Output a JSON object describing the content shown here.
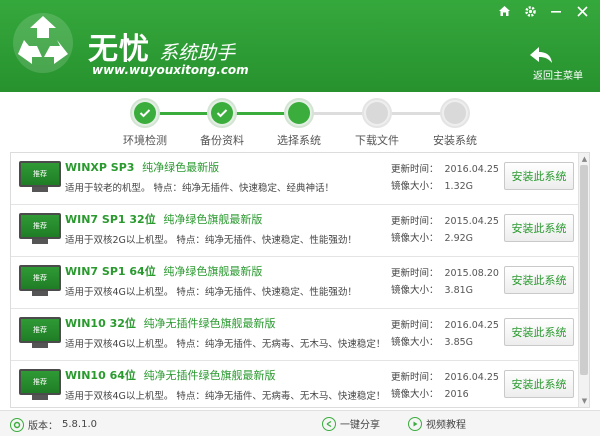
{
  "brand": {
    "name": "无忧",
    "tagline": "系统助手",
    "url": "www.wuyouxitong.com"
  },
  "header": {
    "back_label": "返回主菜单",
    "controls": [
      "home-icon",
      "gear-icon",
      "minimize-icon",
      "close-icon"
    ]
  },
  "steps": [
    {
      "label": "环境检测",
      "state": "done"
    },
    {
      "label": "备份资料",
      "state": "done"
    },
    {
      "label": "选择系统",
      "state": "current"
    },
    {
      "label": "下载文件",
      "state": "todo"
    },
    {
      "label": "安装系统",
      "state": "todo"
    }
  ],
  "list": {
    "thumb_label": "推荐",
    "updated_label": "更新时间：",
    "size_label": "镜像大小：",
    "install_label": "安装此系统",
    "items": [
      {
        "name": "WINXP SP3",
        "subtitle": "纯净绿色最新版",
        "desc": "适用于较老的机型。 特点：纯净无插件、快速稳定、经典神话！",
        "date": "2016.04.25",
        "size": "1.32G"
      },
      {
        "name": "WIN7 SP1 32位",
        "subtitle": "纯净绿色旗舰最新版",
        "desc": "适用于双核2G以上机型。 特点：纯净无插件、快速稳定、性能强劲！",
        "date": "2015.04.25",
        "size": "2.92G"
      },
      {
        "name": "WIN7 SP1 64位",
        "subtitle": "纯净绿色旗舰最新版",
        "desc": "适用于双核4G以上机型。 特点：纯净无插件、快速稳定、性能强劲！",
        "date": "2015.08.20",
        "size": "3.81G"
      },
      {
        "name": "WIN10 32位",
        "subtitle": "纯净无插件绿色旗舰最新版",
        "desc": "适用于双核4G以上机型。 特点：纯净无插件、无病毒、无木马、快速稳定！",
        "date": "2016.04.25",
        "size": "3.85G"
      },
      {
        "name": "WIN10 64位",
        "subtitle": "纯净无插件绿色旗舰最新版",
        "desc": "适用于双核4G以上机型。 特点：纯净无插件、无病毒、无木马、快速稳定！",
        "date": "2016.04.25",
        "size": "2016"
      }
    ]
  },
  "footer": {
    "version_label": "版本：",
    "version": "5.8.1.0",
    "share_label": "一键分享",
    "video_label": "视频教程"
  },
  "colors": {
    "brand_green": "#2a9a2f",
    "header_bg": "#35a83c"
  }
}
